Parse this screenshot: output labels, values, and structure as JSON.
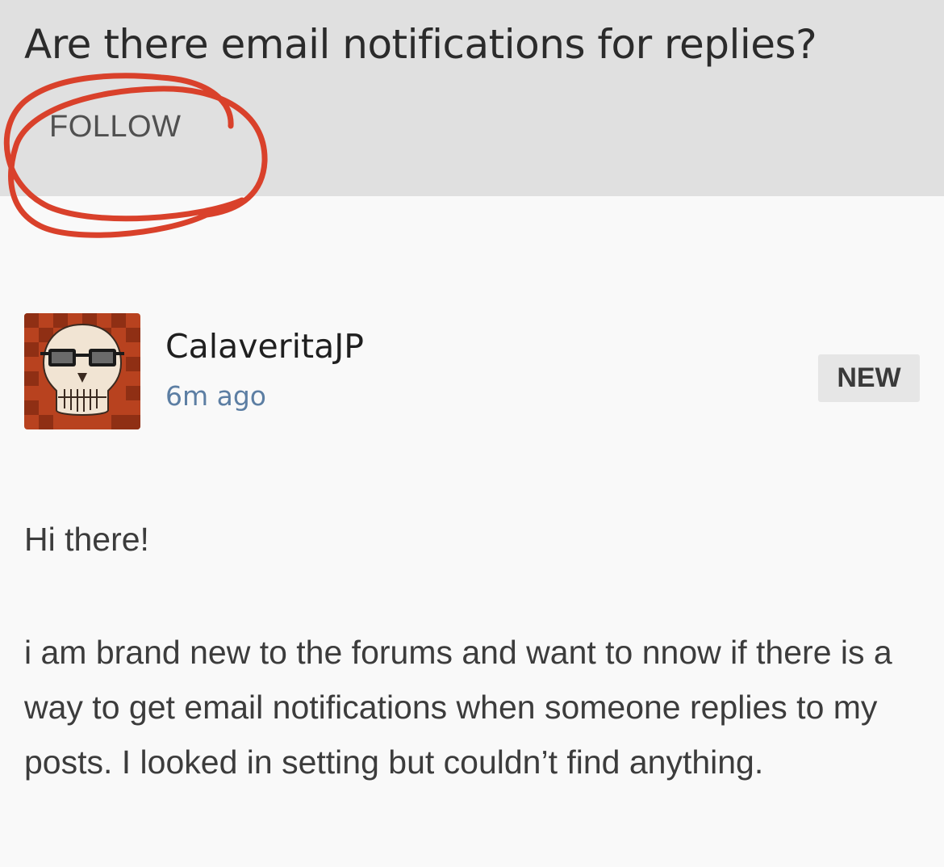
{
  "post": {
    "title": "Are there email notifications for replies?",
    "follow_label": "FOLLOW",
    "author": "CalaveritaJP",
    "timestamp": "6m ago",
    "badge": "NEW",
    "greeting": "Hi there!",
    "body": "i am brand new to the forums and want to nnow if there is a way to get email notifications when someone replies to my posts. I looked in setting but couldn’t find anything."
  },
  "colors": {
    "header_bg": "#e0e0e0",
    "page_bg": "#f9f9f9",
    "annotation": "#d9412b",
    "timestamp": "#5c7ea3",
    "avatar_bg": "#b8421f"
  },
  "icons": {
    "avatar": "skull-with-glasses-avatar"
  }
}
